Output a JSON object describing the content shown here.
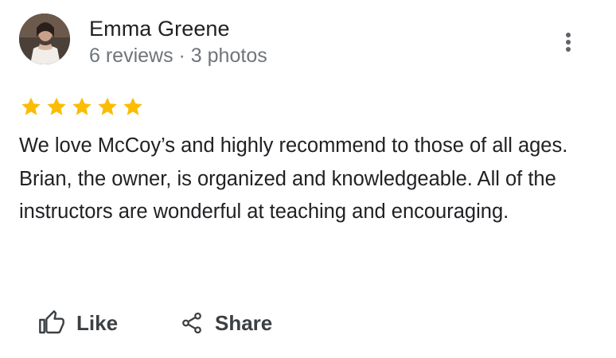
{
  "reviewer": {
    "name": "Emma Greene",
    "meta": "6 reviews · 3 photos",
    "avatar_icon": "profile-photo"
  },
  "review": {
    "rating": 5,
    "rating_max": 5,
    "star_color": "#fbbc04",
    "text": "We love McCoy’s and highly recommend to those of all ages. Brian, the owner, is organized and knowledgeable. All of the instructors are wonderful at teaching and encouraging."
  },
  "actions": {
    "like_label": "Like",
    "share_label": "Share",
    "like_icon": "thumbs-up-icon",
    "share_icon": "share-icon",
    "more_icon": "more-vert-icon"
  }
}
